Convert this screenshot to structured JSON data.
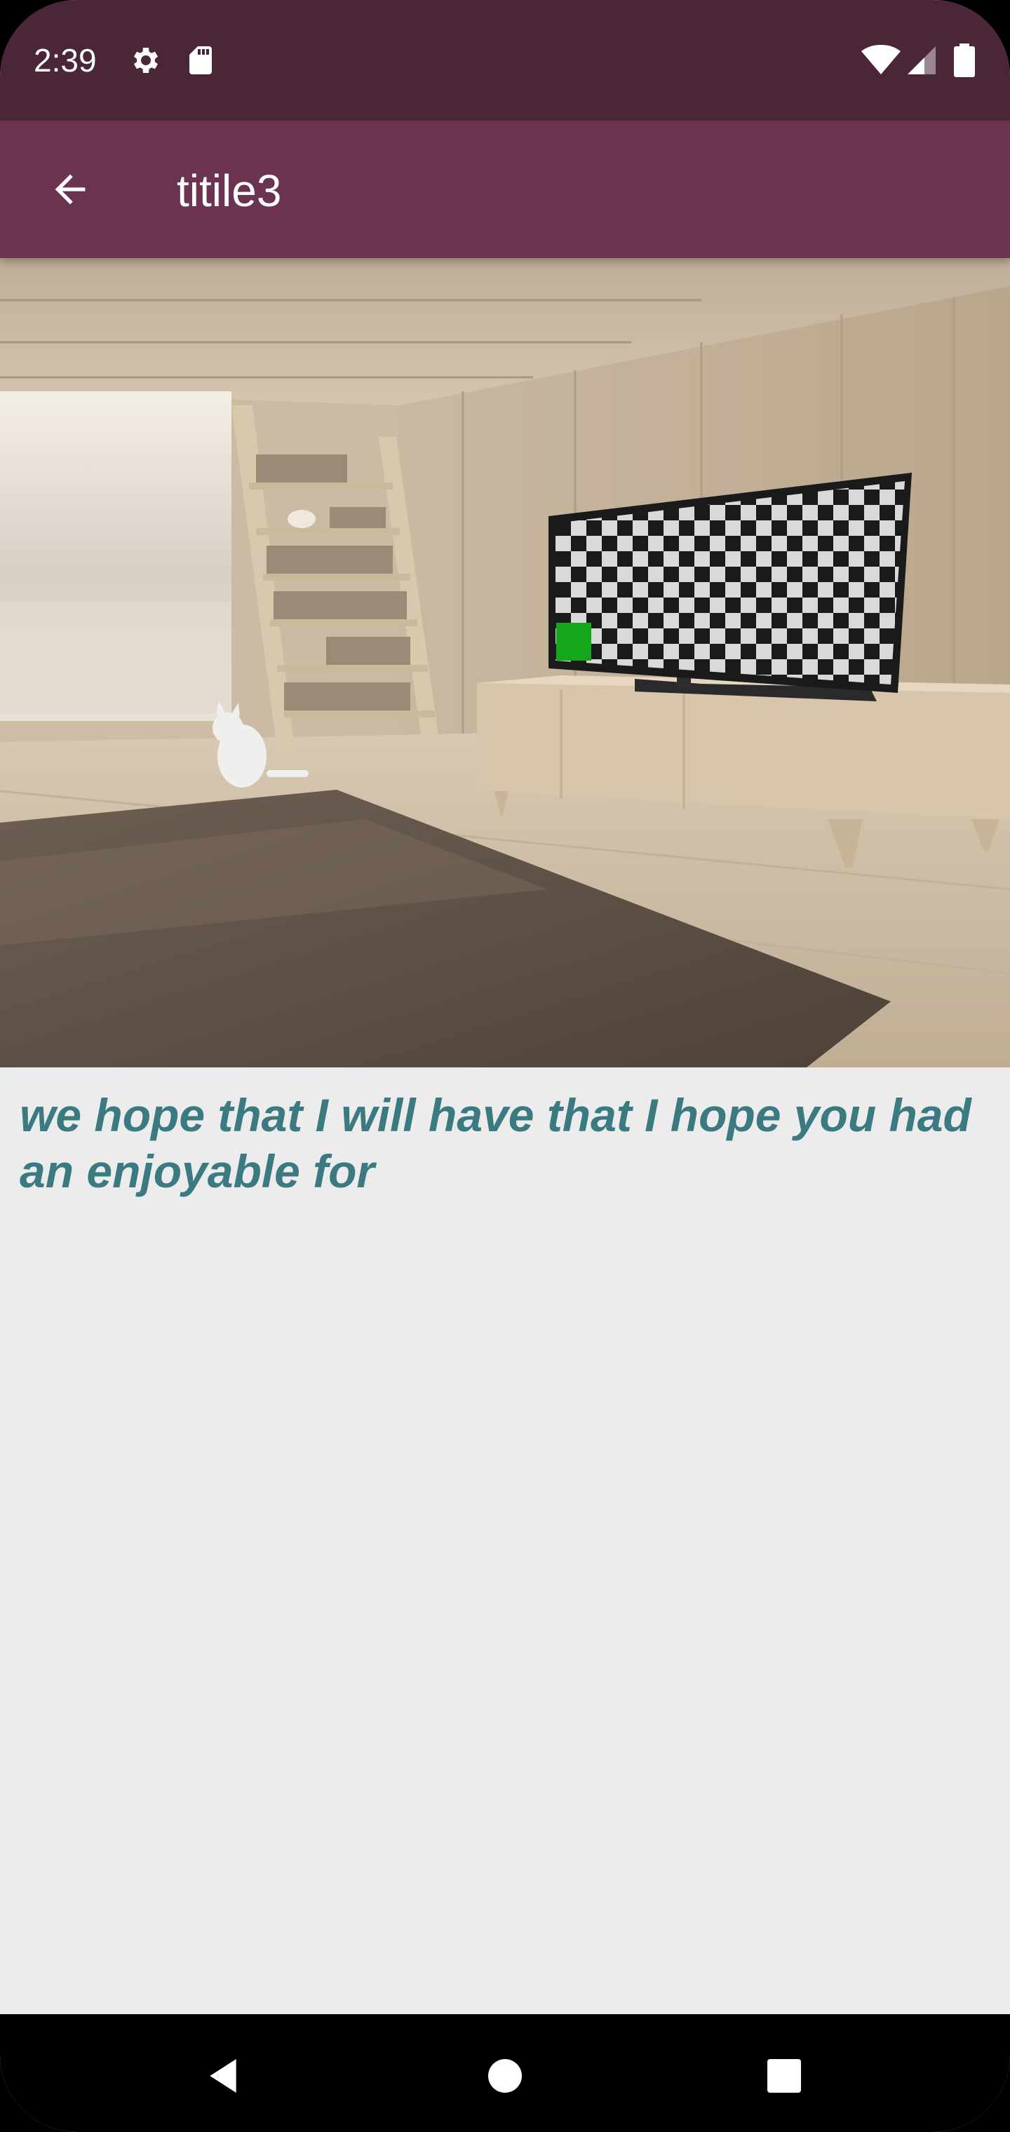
{
  "status_bar": {
    "time": "2:39",
    "icons": [
      "settings-icon",
      "sd-card-icon",
      "wifi-icon",
      "signal-icon",
      "battery-icon"
    ]
  },
  "app_bar": {
    "title": "titile3",
    "back_icon": "arrow-back-icon"
  },
  "content": {
    "image_description_icon": "room-illustration",
    "body_text": "we hope that I will have that I hope you had an enjoyable for"
  },
  "nav_bar": {
    "icons": [
      "back-triangle-icon",
      "home-circle-icon",
      "recents-square-icon"
    ]
  },
  "colors": {
    "status_bar": "#4b2638",
    "app_bar": "#6b3350",
    "background": "#ececec",
    "body_text": "#3a7a80",
    "nav_bar": "#000000"
  }
}
